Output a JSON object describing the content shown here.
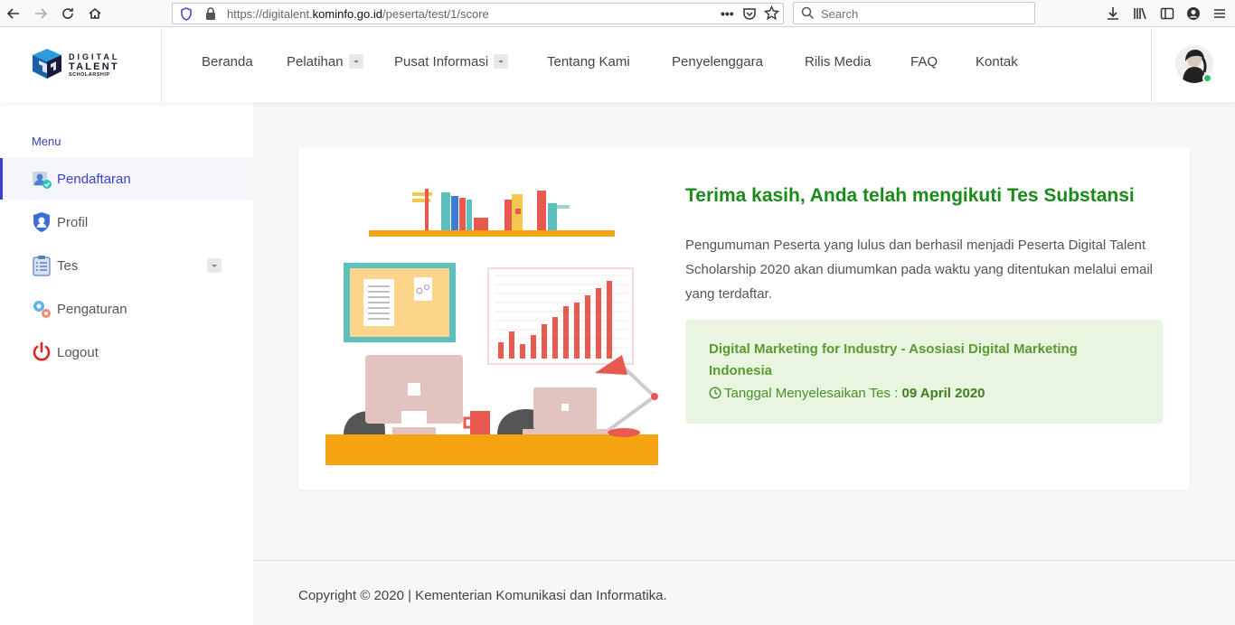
{
  "browser": {
    "url_prefix": "https://digitalent.",
    "url_domain": "kominfo.go.id",
    "url_path": "/peserta/test/1/score",
    "search_placeholder": "Search"
  },
  "logo": {
    "line1": "DIGITAL",
    "line2": "TALENT",
    "line3": "SCHOLARSHIP"
  },
  "nav": {
    "items": [
      {
        "label": "Beranda"
      },
      {
        "label": "Pelatihan"
      },
      {
        "label": "Pusat Informasi"
      },
      {
        "label": "Tentang Kami"
      },
      {
        "label": "Penyelenggara"
      },
      {
        "label": "Rilis Media"
      },
      {
        "label": "FAQ"
      },
      {
        "label": "Kontak"
      }
    ]
  },
  "sidebar": {
    "menu_label": "Menu",
    "items": [
      {
        "label": "Pendaftaran",
        "icon": "registration-icon"
      },
      {
        "label": "Profil",
        "icon": "profile-shield-icon"
      },
      {
        "label": "Tes",
        "icon": "clipboard-icon"
      },
      {
        "label": "Pengaturan",
        "icon": "gears-icon"
      },
      {
        "label": "Logout",
        "icon": "power-icon"
      }
    ]
  },
  "main": {
    "title": "Terima kasih, Anda telah mengikuti Tes Substansi",
    "description": "Pengumuman Peserta yang lulus dan berhasil menjadi Peserta Digital Talent Scholarship 2020 akan diumumkan pada waktu yang ditentukan melalui email yang terdaftar.",
    "course_name": "Digital Marketing for Industry - Asosiasi Digital Marketing Indonesia",
    "date_label": "Tanggal Menyelesaikan Tes :",
    "date_value": "09 April 2020"
  },
  "footer": {
    "text": "Copyright © 2020 | Kementerian Komunikasi dan Informatika."
  },
  "colors": {
    "title_green": "#1a8a1a",
    "course_box_bg": "#e8f5e1",
    "active_blue": "#3b3fd8",
    "shelf_orange": "#f5a311"
  }
}
